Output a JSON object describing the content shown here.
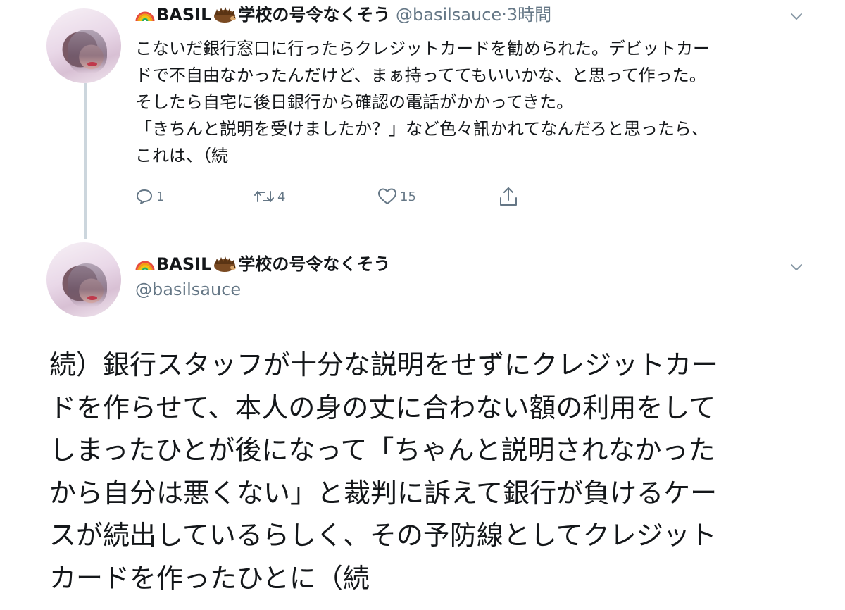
{
  "tweet1": {
    "display_name": "BASIL",
    "display_name_suffix": "学校の号令なくそう",
    "handle": "@basilsauce",
    "separator": "·",
    "time": "3時間",
    "text_lines": [
      "こないだ銀行窓口に行ったらクレジットカードを勧められた。デビットカー",
      "ドで不自由なかったんだけど、まぁ持っててもいいかな、と思って作った。",
      "そしたら自宅に後日銀行から確認の電話がかかってきた。",
      "「きちんと説明を受けましたか？」など色々訊かれてなんだろと思ったら、",
      "これは、（続"
    ],
    "reply_count": "1",
    "retweet_count": "4",
    "like_count": "15"
  },
  "tweet2": {
    "display_name": "BASIL",
    "display_name_suffix": "学校の号令なくそう",
    "handle": "@basilsauce",
    "text_lines": [
      "続）銀行スタッフが十分な説明をせずにクレジットカー",
      "ドを作らせて、本人の身の丈に合わない額の利用をして",
      "しまったひとが後になって「ちゃんと説明されなかった",
      "から自分は悪くない」と裁判に訴えて銀行が負けるケー",
      "スが続出しているらしく、その予防線としてクレジット",
      "カードを作ったひとに（続"
    ]
  },
  "icons": {
    "avatar": "avatar-icon",
    "rainbow": "rainbow-icon",
    "hedgehog": "hedgehog-icon",
    "chevron": "chevron-down-icon",
    "reply": "reply-icon",
    "retweet": "retweet-icon",
    "like": "heart-icon",
    "share": "share-icon"
  },
  "colors": {
    "text": "#14171a",
    "muted": "#657786",
    "thread_line": "#ccd6dd"
  }
}
